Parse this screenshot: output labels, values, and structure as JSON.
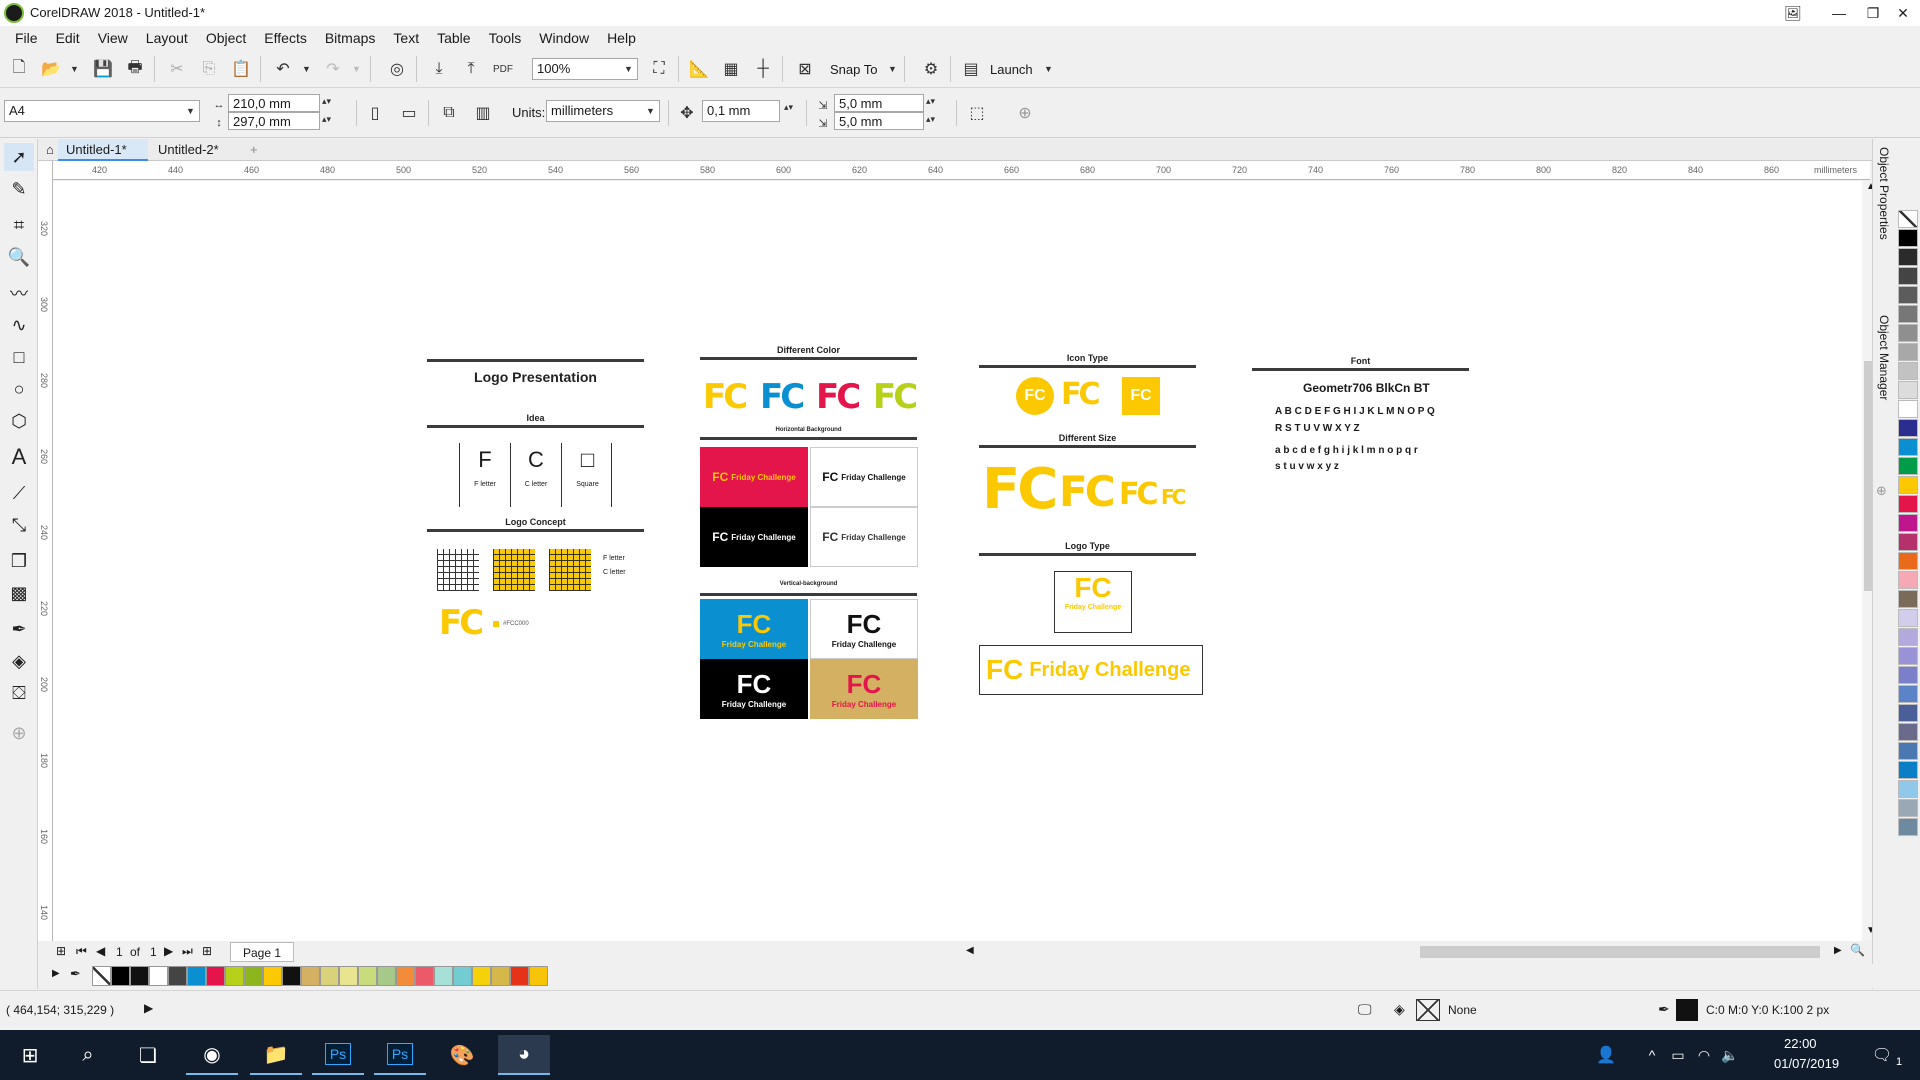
{
  "window": {
    "title": "CorelDRAW 2018 - Untitled-1*"
  },
  "menu": [
    "File",
    "Edit",
    "View",
    "Layout",
    "Object",
    "Effects",
    "Bitmaps",
    "Text",
    "Table",
    "Tools",
    "Window",
    "Help"
  ],
  "toolbar": {
    "zoom": "100%",
    "snap_to": "Snap To",
    "launch": "Launch"
  },
  "property_bar": {
    "page_size": "A4",
    "width": "210,0 mm",
    "height": "297,0 mm",
    "units_label": "Units:",
    "units": "millimeters",
    "nudge": "0,1 mm",
    "dup_x": "5,0 mm",
    "dup_y": "5,0 mm"
  },
  "tabs": [
    "Untitled-1*",
    "Untitled-2*"
  ],
  "ruler": {
    "h_ticks": [
      "420",
      "440",
      "460",
      "480",
      "500",
      "520",
      "540",
      "560",
      "580",
      "600",
      "620",
      "640",
      "660",
      "680",
      "700",
      "720",
      "740",
      "760",
      "780",
      "800",
      "820",
      "840",
      "860"
    ],
    "h_unit": "millimeters",
    "v_ticks": [
      "320",
      "300",
      "280",
      "260",
      "240",
      "220",
      "200",
      "180",
      "160",
      "140"
    ]
  },
  "dockers": [
    "Object Properties",
    "Object Manager"
  ],
  "page_nav": {
    "current": "1",
    "of": "of",
    "total": "1",
    "page_tab": "Page 1"
  },
  "status": {
    "coords": "( 464,154; 315,229 )",
    "fill": "None",
    "outline": "C:0 M:0 Y:0 K:100  2 px"
  },
  "taskbar": {
    "time": "22:00",
    "date": "01/07/2019",
    "notif": "1"
  },
  "colors": {
    "brand_yellow": "#fcc800",
    "red": "#e4154a",
    "blue": "#0a8fd1",
    "lime": "#b7d11b",
    "gold": "#d4b062"
  },
  "artboard": {
    "logo_presentation": "Logo Presentation",
    "idea": "Idea",
    "idea_cells": [
      {
        "glyph": "F",
        "label": "F letter"
      },
      {
        "glyph": "C",
        "label": "C letter"
      },
      {
        "glyph": "□",
        "label": "Square"
      }
    ],
    "logo_concept": "Logo Concept",
    "f_letter": "F letter",
    "c_letter": "C letter",
    "hex": "#FCC000",
    "different_color": "Different Color",
    "horizontal_bg": "Horizontal Background",
    "vertical_bg": "Vertical-background",
    "brand": "Friday Challenge",
    "icon_type": "Icon Type",
    "different_size": "Different Size",
    "logo_type": "Logo Type",
    "font": "Font",
    "font_name": "Geometr706 BlkCn BT",
    "upper1": "A B C D E F G H I J K L M N O P Q",
    "upper2": "R S T U V W X Y Z",
    "lower1": "a b c d e f g h i j k l m n o p q r",
    "lower2": "s t u v w x y z"
  }
}
